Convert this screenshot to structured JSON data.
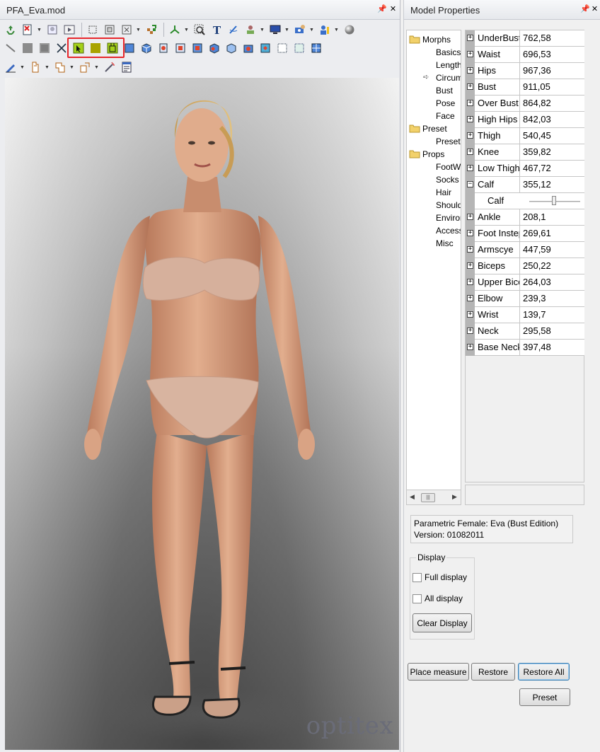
{
  "viewport_window": {
    "title": "PFA_Eva.mod",
    "brand": "optitex"
  },
  "properties_window": {
    "title": "Model Properties"
  },
  "toolbar_icons": {
    "row1": [
      "recycle-icon",
      "new-model-icon",
      "open-model-icon",
      "play-icon",
      "frame-icon",
      "select-frame-icon",
      "close-frame-icon",
      "checker-icon",
      "axes-icon",
      "zoom-fit-icon",
      "text-icon",
      "pen-icon",
      "stamp-icon",
      "display-icon",
      "camera-group-icon",
      "avatar-group-icon",
      "sphere-icon"
    ],
    "row2": [
      "line-tool-icon",
      "square-tool-icon",
      "square-dark-icon",
      "cross-tool-icon",
      "select-arrow-icon",
      "fill-square-icon",
      "select-fill-icon",
      "view-front-icon",
      "view-back-icon",
      "view-left-icon",
      "view-right-icon",
      "view-top-icon",
      "view-bottom-icon",
      "view-iso-icon",
      "view-iso2-icon",
      "view-persp-icon",
      "grid-dots-icon",
      "grid-fine-icon",
      "grid-blue-icon"
    ],
    "row3": [
      "pencil-icon",
      "copy-pieces-icon",
      "paste-pieces-icon",
      "transform-pieces-icon",
      "magic-wand-icon",
      "report-icon"
    ]
  },
  "tree": {
    "items": [
      {
        "label": "Morphs",
        "type": "folder"
      },
      {
        "label": "Basics",
        "type": "leaf"
      },
      {
        "label": "Length",
        "type": "leaf"
      },
      {
        "label": "Circumference",
        "type": "leaf",
        "active": true
      },
      {
        "label": "Bust",
        "type": "leaf"
      },
      {
        "label": "Pose",
        "type": "leaf"
      },
      {
        "label": "Face",
        "type": "leaf"
      },
      {
        "label": "Preset",
        "type": "folder"
      },
      {
        "label": "Preset",
        "type": "leaf"
      },
      {
        "label": "Props",
        "type": "folder"
      },
      {
        "label": "FootWear",
        "type": "leaf"
      },
      {
        "label": "Socks",
        "type": "leaf"
      },
      {
        "label": "Hair",
        "type": "leaf"
      },
      {
        "label": "Shoulders",
        "type": "leaf"
      },
      {
        "label": "Environment",
        "type": "leaf"
      },
      {
        "label": "Accessories",
        "type": "leaf"
      },
      {
        "label": "Misc",
        "type": "leaf"
      }
    ]
  },
  "properties": {
    "rows": [
      {
        "name": "UnderBust",
        "value": "762,58",
        "expander": "+"
      },
      {
        "name": "Waist",
        "value": "696,53",
        "expander": "+"
      },
      {
        "name": "Hips",
        "value": "967,36",
        "expander": "+"
      },
      {
        "name": "Bust",
        "value": "911,05",
        "expander": "+"
      },
      {
        "name": "Over Bust",
        "value": "864,82",
        "expander": "+"
      },
      {
        "name": "High Hips",
        "value": "842,03",
        "expander": "+"
      },
      {
        "name": "Thigh",
        "value": "540,45",
        "expander": "+"
      },
      {
        "name": "Knee",
        "value": "359,82",
        "expander": "+"
      },
      {
        "name": "Low Thigh",
        "value": "467,72",
        "expander": "+"
      },
      {
        "name": "Calf",
        "value": "355,12",
        "expander": "−"
      },
      {
        "name": "Calf",
        "value": "",
        "expander": "",
        "sub": true
      },
      {
        "name": "Ankle",
        "value": "208,1",
        "expander": "+"
      },
      {
        "name": "Foot Instep",
        "value": "269,61",
        "expander": "+"
      },
      {
        "name": "Armscye",
        "value": "447,59",
        "expander": "+"
      },
      {
        "name": "Biceps",
        "value": "250,22",
        "expander": "+"
      },
      {
        "name": "Upper Biceps",
        "value": "264,03",
        "expander": "+"
      },
      {
        "name": "Elbow",
        "value": "239,3",
        "expander": "+"
      },
      {
        "name": "Wrist",
        "value": "139,7",
        "expander": "+"
      },
      {
        "name": "Neck",
        "value": "295,58",
        "expander": "+"
      },
      {
        "name": "Base Neck",
        "value": "397,48",
        "expander": "+"
      }
    ]
  },
  "info": {
    "model_name": "Parametric Female: Eva (Bust Edition)",
    "version": "Version: 01082011"
  },
  "display": {
    "legend": "Display",
    "full_display_label": "Full display",
    "all_display_label": "All display",
    "clear_display_label": "Clear Display"
  },
  "buttons": {
    "place_measure": "Place measure",
    "restore": "Restore",
    "restore_all": "Restore All",
    "preset": "Preset"
  },
  "colors": {
    "highlight": "#e8262b",
    "skin": "#d9a384",
    "underwear": "#d8b4a0"
  }
}
